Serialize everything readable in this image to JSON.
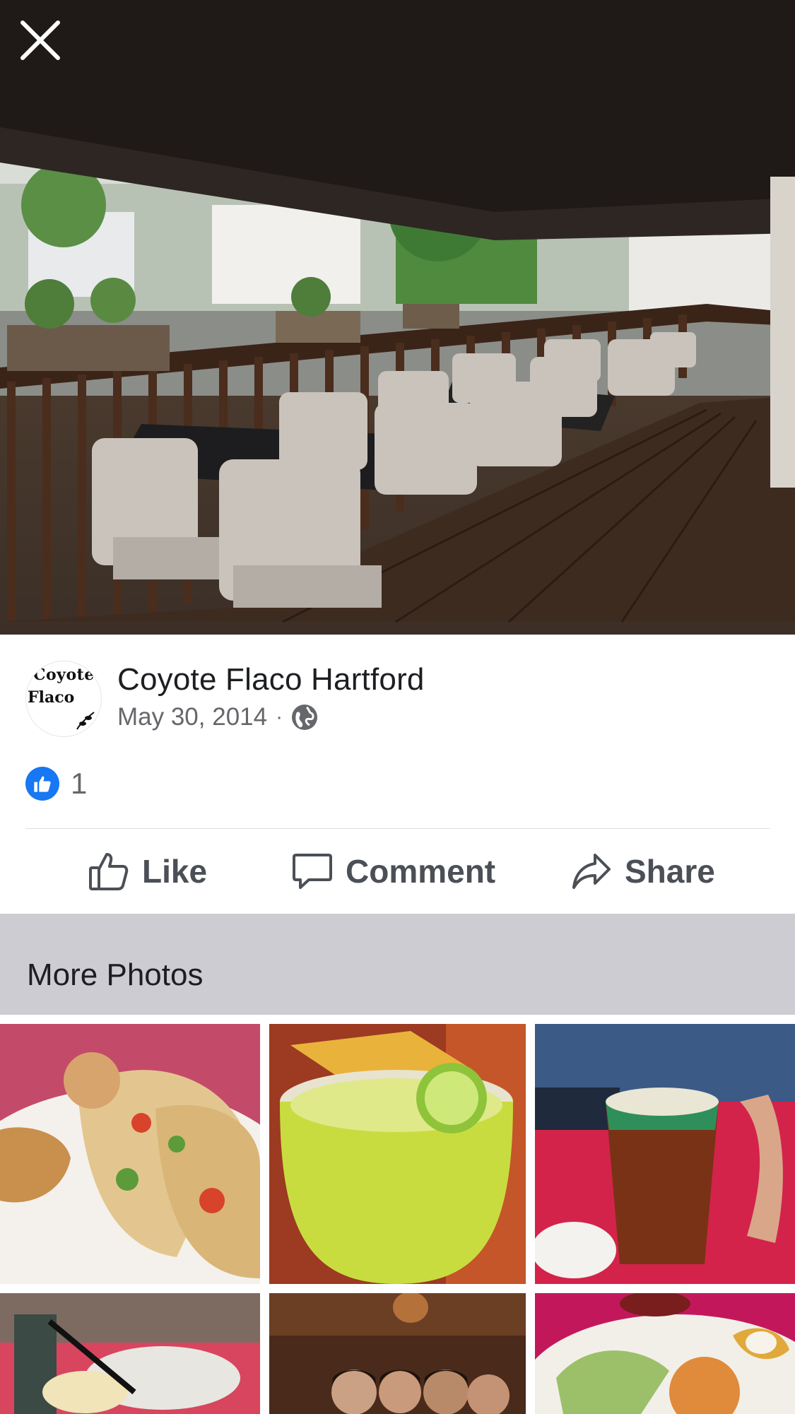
{
  "viewer": {
    "close_icon": "close-icon"
  },
  "post": {
    "page_name": "Coyote Flaco Hartford",
    "avatar_text_line1": "Coyote",
    "avatar_text_line2": "Flaco",
    "date": "May 30, 2014",
    "separator": "·",
    "privacy_icon": "globe-icon",
    "like_count": "1"
  },
  "actions": {
    "like_label": "Like",
    "comment_label": "Comment",
    "share_label": "Share"
  },
  "more_photos": {
    "title": "More Photos",
    "thumbnails": [
      {
        "name": "tacos-photo",
        "color": "#c9a77a"
      },
      {
        "name": "margarita-photo",
        "color": "#b9d24a"
      },
      {
        "name": "beer-photo",
        "color": "#7a2a18"
      },
      {
        "name": "drinks-photo",
        "color": "#d8455e"
      },
      {
        "name": "group-photo",
        "color": "#4a2a1a"
      },
      {
        "name": "enchiladas-photo",
        "color": "#c2185b"
      }
    ]
  },
  "colors": {
    "accent": "#1877f2",
    "section_band": "#ccccd2",
    "secondary_text": "#65676b"
  }
}
